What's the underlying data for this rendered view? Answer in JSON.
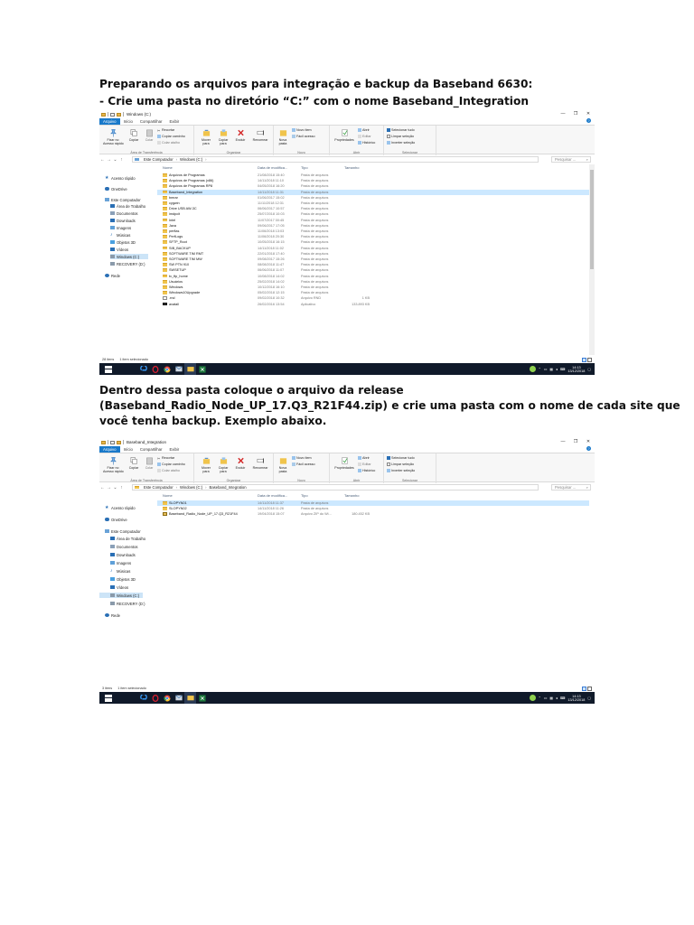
{
  "doc": {
    "heading": "Preparando os arquivos para integração e backup da Baseband 6630:",
    "step1": "- Crie uma pasta no diretório “C:” com o nome Baseband_Integration",
    "step2_line1": "Dentro dessa pasta coloque o arquivo da release",
    "step2_line2": "(Baseband_Radio_Node_UP_17.Q3_R21F44.zip) e crie uma pasta com o nome de cada site que",
    "step2_line3": "você tenha backup. Exemplo abaixo."
  },
  "colors": {
    "accent": "#1979ca",
    "selection": "#cce8ff",
    "folder": "#f0c44c",
    "taskbar": "#101a2a"
  },
  "ribbon": {
    "tabs": [
      "Arquivo",
      "Início",
      "Compartilhar",
      "Exibir"
    ],
    "pin_label": "Fixar no\nAcesso rápido",
    "copy_label": "Copiar",
    "paste_label": "Colar",
    "cut": "Recortar",
    "copy_path": "Copiar caminho",
    "paste_shortcut": "Colar atalho",
    "move_label": "Mover\npara",
    "copyto_label": "Copiar\npara",
    "delete_label": "Excluir",
    "rename_label": "Renomear",
    "newfolder_label": "Nova\npasta",
    "new_item": "Novo item",
    "easy_access": "Fácil acesso",
    "properties_label": "Propriedades",
    "open": "Abrir",
    "edit": "Editar",
    "history": "Histórico",
    "select_all": "Selecionar tudo",
    "select_none": "Limpar seleção",
    "invert_selection": "Inverter seleção",
    "groups": [
      "Área de Transferência",
      "Organizar",
      "Novo",
      "Abrir",
      "Selecionar"
    ]
  },
  "nav_pane": [
    "Acesso rápido",
    "OneDrive",
    "Este Computador",
    "Área de Trabalho",
    "Documentos",
    "Downloads",
    "Imagens",
    "Músicas",
    "Objetos 3D",
    "Vídeos",
    "Windows (C:)",
    "RECOVERY (D:)",
    "Rede"
  ],
  "columns": [
    "Nome",
    "Data de modifica...",
    "Tipo",
    "Tamanho"
  ],
  "search_placeholder": "Pesquisar ...",
  "taskbar": {
    "time": "14:13",
    "date": "13/12/2018"
  },
  "win1": {
    "title": "Windows (C:)",
    "path": [
      "Este Computador",
      "Windows (C:)"
    ],
    "status_count": "28 itens",
    "status_selected": "1 item selecionado",
    "rows": [
      {
        "name": "Arquivos de Programas",
        "date": "21/08/2018 15:40",
        "type": "Pasta de arquivos",
        "size": ""
      },
      {
        "name": "Arquivos de Programas (x86)",
        "date": "14/11/2018 11:10",
        "type": "Pasta de arquivos",
        "size": ""
      },
      {
        "name": "Arquivos de Programas RP8",
        "date": "04/05/2018 16:20",
        "type": "Pasta de arquivos",
        "size": ""
      },
      {
        "name": "Baseband_Integration",
        "date": "14/11/2018 11:31",
        "type": "Pasta de arquivos",
        "size": ""
      },
      {
        "name": "bmrar",
        "date": "01/06/2017 15:02",
        "type": "Pasta de arquivos",
        "size": ""
      },
      {
        "name": "cygwin",
        "date": "11/11/2018 12:31",
        "type": "Pasta de arquivos",
        "size": ""
      },
      {
        "name": "Drive USB AW-3C",
        "date": "06/06/2017 10:57",
        "type": "Pasta de arquivos",
        "size": ""
      },
      {
        "name": "imdpcit",
        "date": "25/07/2018 10:03",
        "type": "Pasta de arquivos",
        "size": ""
      },
      {
        "name": "Intel",
        "date": "11/07/2017 00:45",
        "type": "Pasta de arquivos",
        "size": ""
      },
      {
        "name": "Java",
        "date": "09/06/2017 17:05",
        "type": "Pasta de arquivos",
        "size": ""
      },
      {
        "name": "perflas",
        "date": "11/06/2018 13:03",
        "type": "Pasta de arquivos",
        "size": ""
      },
      {
        "name": "PerfLogs",
        "date": "11/06/2018 20:30",
        "type": "Pasta de arquivos",
        "size": ""
      },
      {
        "name": "SFTP_Root",
        "date": "10/05/2018 16:15",
        "type": "Pasta de arquivos",
        "size": ""
      },
      {
        "name": "SIB_BACKUP",
        "date": "14/11/2018 11:02",
        "type": "Pasta de arquivos",
        "size": ""
      },
      {
        "name": "SOFTWARE TIM RMT",
        "date": "22/01/2018 17:40",
        "type": "Pasta de arquivos",
        "size": ""
      },
      {
        "name": "SOFTWARE TIM MW",
        "date": "09/08/2017 15:26",
        "type": "Pasta de arquivos",
        "size": ""
      },
      {
        "name": "SW PTN 910",
        "date": "08/08/2018 11:47",
        "type": "Pasta de arquivos",
        "size": ""
      },
      {
        "name": "SWSETUP",
        "date": "06/06/2018 11:07",
        "type": "Pasta de arquivos",
        "size": ""
      },
      {
        "name": "tx_ftp_home",
        "date": "10/08/2018 14:02",
        "type": "Pasta de arquivos",
        "size": ""
      },
      {
        "name": "Usuários",
        "date": "25/02/2018 14:02",
        "type": "Pasta de arquivos",
        "size": ""
      },
      {
        "name": "Windows",
        "date": "10/12/2018 16:10",
        "type": "Pasta de arquivos",
        "size": ""
      },
      {
        "name": "Windows10Upgrade",
        "date": "05/02/2018 12:15",
        "type": "Pasta de arquivos",
        "size": ""
      },
      {
        "name": ".rnd",
        "date": "09/02/2018 10:32",
        "type": "Arquivo RND",
        "size": "1 KB"
      },
      {
        "name": "avatall",
        "date": "26/02/2016 13:54",
        "type": "Aplicativo",
        "size": "133.893 KB"
      }
    ]
  },
  "win2": {
    "title": "Baseband_Integration",
    "path": [
      "Este Computador",
      "Windows (C:)",
      "Baseband_Integration"
    ],
    "status_count": "3 itens",
    "status_selected": "1 item selecionado",
    "rows": [
      {
        "name": "SLOPYN01",
        "date": "14/11/2018 11:37",
        "type": "Pasta de arquivos",
        "size": ""
      },
      {
        "name": "SLOPYN02",
        "date": "14/11/2018 11:26",
        "type": "Pasta de arquivos",
        "size": ""
      },
      {
        "name": "Baseband_Radio_Node_UP_17.Q3_R21F44",
        "date": "19/04/2018 15:07",
        "type": "Arquivo ZIP do Wi...",
        "size": "180.452 KB"
      }
    ]
  }
}
